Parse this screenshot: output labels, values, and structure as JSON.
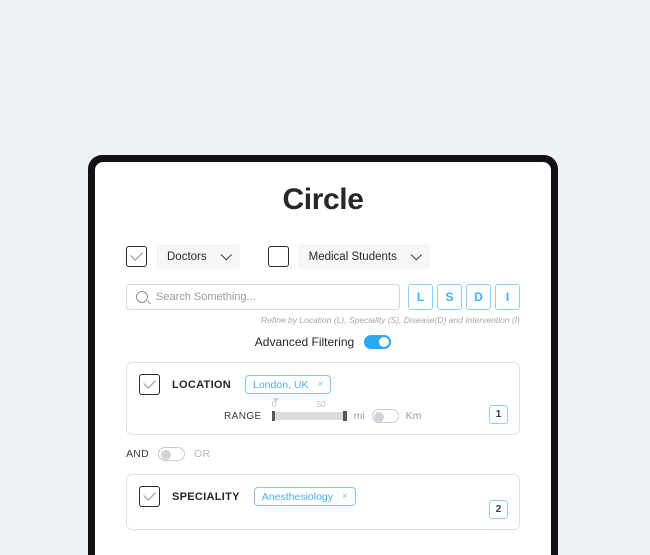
{
  "app": {
    "title": "Circle"
  },
  "audience": [
    {
      "name": "doctors",
      "label": "Doctors",
      "checked": true,
      "caret_icon": "chevron-down-icon"
    },
    {
      "name": "medical-students",
      "label": "Medical Students",
      "checked": false,
      "caret_icon": "chevron-down-icon"
    }
  ],
  "search": {
    "icon": "search-icon",
    "placeholder": "Search Something...",
    "value": "",
    "hint": "Refine by Location (L), Speciality (S), Disease(D) and Intervention (I)",
    "refine_buttons": [
      "L",
      "S",
      "D",
      "I"
    ]
  },
  "advanced_filtering": {
    "label": "Advanced Filtering",
    "enabled": true
  },
  "filters": [
    {
      "name": "location",
      "title": "LOCATION",
      "checked": true,
      "chips": [
        {
          "label": "London, UK",
          "close_icon": "close-icon"
        }
      ],
      "badge": "1",
      "range": {
        "label": "RANGE",
        "min_tick": "0",
        "max_tick": "50",
        "value_min": 0,
        "value_max": 50,
        "unit_left": "mi",
        "unit_right": "Km",
        "unit_toggle_on": false
      }
    },
    {
      "name": "speciality",
      "title": "SPECIALITY",
      "checked": true,
      "chips": [
        {
          "label": "Anesthesiology",
          "close_icon": "close-icon"
        }
      ],
      "badge": "2"
    }
  ],
  "logic_operator": {
    "left_label": "AND",
    "right_label": "OR",
    "enabled": false
  },
  "colors": {
    "accent_blue": "#2aa8f2",
    "chip_blue": "#45b0f5",
    "page_background": "#eff2f5",
    "frame_black": "#111114"
  }
}
